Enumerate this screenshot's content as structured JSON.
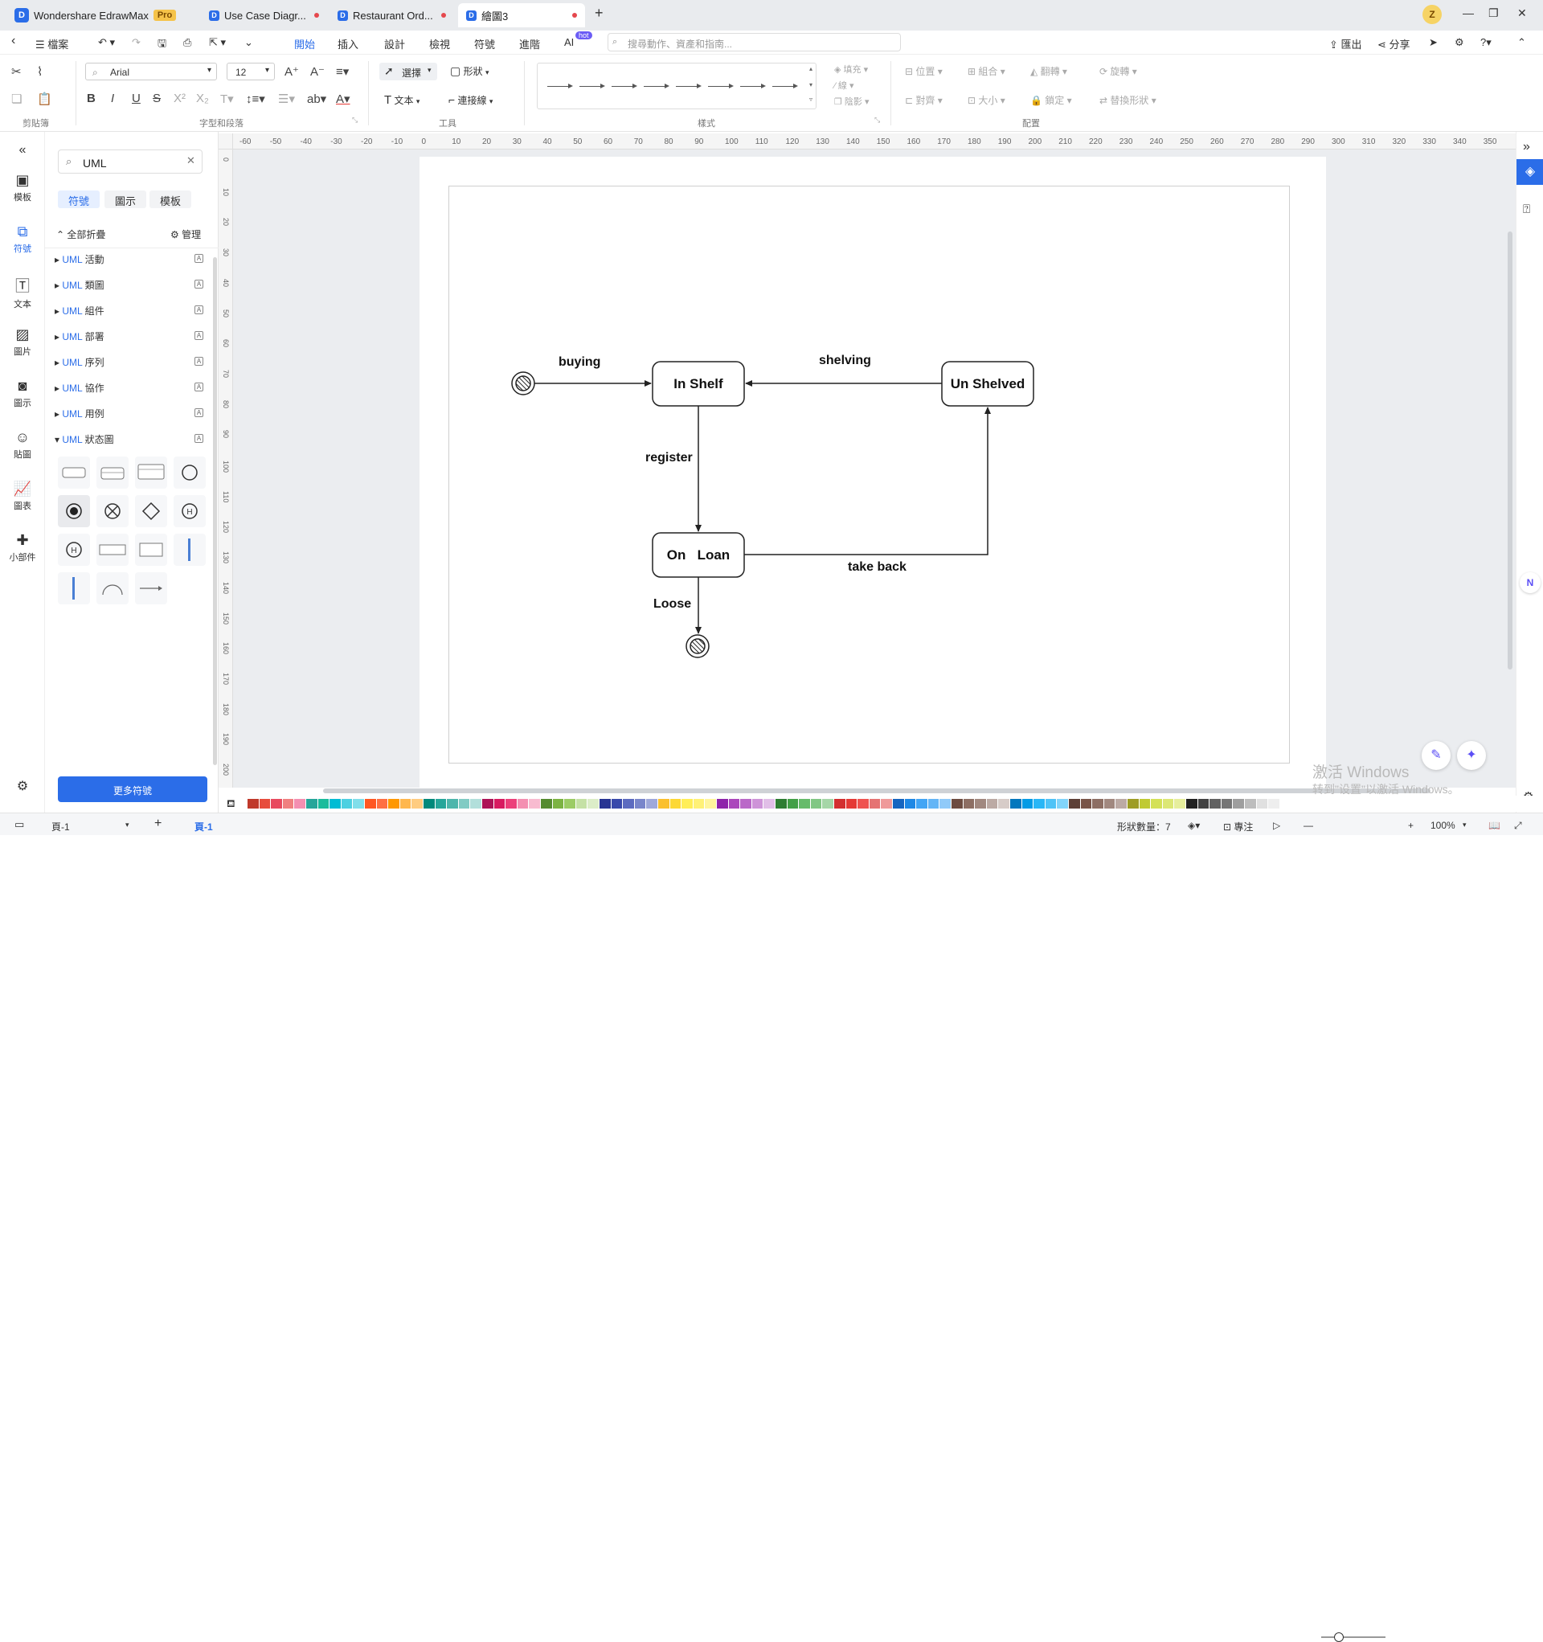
{
  "tabs": [
    {
      "label": "Wondershare EdrawMax",
      "badge": "Pro"
    },
    {
      "label": "Use Case Diagr..."
    },
    {
      "label": "Restaurant Ord..."
    },
    {
      "label": "繪圖3"
    }
  ],
  "user_initial": "Z",
  "menubar": {
    "file": "檔案",
    "items": [
      "開始",
      "插入",
      "設計",
      "檢視",
      "符號",
      "進階",
      "AI"
    ],
    "ai_badge": "hot",
    "search_placeholder": "搜尋動作、資產和指南...",
    "export": "匯出",
    "share": "分享"
  },
  "ribbon": {
    "font_name": "Arial",
    "font_size": "12",
    "select_label": "選擇",
    "shape_label": "形狀",
    "text_label": "文本",
    "connector_label": "連接線",
    "fill_label": "填充",
    "line_label": "線",
    "shadow_label": "陰影",
    "position_label": "位置",
    "group_label": "組合",
    "flip_label": "翻轉",
    "rotate_label": "旋轉",
    "align_label": "對齊",
    "size_label": "大小",
    "lock_label": "鎖定",
    "replace_label": "替換形狀",
    "groups": {
      "clipboard": "剪貼簿",
      "font": "字型和段落",
      "tools": "工具",
      "style": "樣式",
      "arrange": "配置"
    }
  },
  "left_rail": [
    {
      "label": "模板",
      "icon": "template-icon"
    },
    {
      "label": "符號",
      "icon": "symbol-icon"
    },
    {
      "label": "文本",
      "icon": "text-icon"
    },
    {
      "label": "圖片",
      "icon": "image-icon"
    },
    {
      "label": "圖示",
      "icon": "icon-icon"
    },
    {
      "label": "貼圖",
      "icon": "sticker-icon"
    },
    {
      "label": "圖表",
      "icon": "chart-icon"
    },
    {
      "label": "小部件",
      "icon": "widget-icon"
    }
  ],
  "library": {
    "search_value": "UML",
    "tabs": [
      "符號",
      "圖示",
      "模板"
    ],
    "collapse_all": "全部折疊",
    "manage": "管理",
    "categories": [
      {
        "prefix": "UML",
        "name": "活動"
      },
      {
        "prefix": "UML",
        "name": "類圖"
      },
      {
        "prefix": "UML",
        "name": "組件"
      },
      {
        "prefix": "UML",
        "name": "部署"
      },
      {
        "prefix": "UML",
        "name": "序列"
      },
      {
        "prefix": "UML",
        "name": "協作"
      },
      {
        "prefix": "UML",
        "name": "用例"
      },
      {
        "prefix": "UML",
        "name": "狀态圖"
      }
    ],
    "more_button": "更多符號"
  },
  "ruler": {
    "h_ticks": [
      "-60",
      "-50",
      "-40",
      "-30",
      "-20",
      "-10",
      "0",
      "10",
      "20",
      "30",
      "40",
      "50",
      "60",
      "70",
      "80",
      "90",
      "100",
      "110",
      "120",
      "130",
      "140",
      "150",
      "160",
      "170",
      "180",
      "190",
      "200",
      "210",
      "220",
      "230",
      "240",
      "250",
      "260",
      "270",
      "280",
      "290",
      "300",
      "310",
      "320",
      "330",
      "340",
      "350"
    ],
    "v_ticks": [
      "0",
      "10",
      "20",
      "30",
      "40",
      "50",
      "60",
      "70",
      "80",
      "90",
      "100",
      "110",
      "120",
      "130",
      "140",
      "150",
      "160",
      "170",
      "180",
      "190",
      "200"
    ]
  },
  "diagram": {
    "states": {
      "in_shelf": "In Shelf",
      "un_shelved": "Un Shelved",
      "on_loan": "On   Loan"
    },
    "transitions": {
      "buying": "buying",
      "shelving": "shelving",
      "register": "register",
      "take_back": "take back",
      "loose": "Loose"
    }
  },
  "palette": [
    "#c0392b",
    "#e74c3c",
    "#e84a5f",
    "#f08080",
    "#f48fb1",
    "#26a69a",
    "#1abc9c",
    "#00bcd4",
    "#4dd0e1",
    "#80deea",
    "#ff5722",
    "#ff7043",
    "#ff9800",
    "#ffb74d",
    "#ffcc80",
    "#00897b",
    "#26a69a",
    "#4db6ac",
    "#80cbc4",
    "#b2dfdb",
    "#ad1457",
    "#d81b60",
    "#ec407a",
    "#f48fb1",
    "#f8bbd0",
    "#558b2f",
    "#7cb342",
    "#9ccc65",
    "#c5e1a5",
    "#dcedc8",
    "#283593",
    "#3949ab",
    "#5c6bc0",
    "#7986cb",
    "#9fa8da",
    "#fbc02d",
    "#fdd835",
    "#ffee58",
    "#fff176",
    "#fff59d",
    "#8e24aa",
    "#ab47bc",
    "#ba68c8",
    "#ce93d8",
    "#e1bee7",
    "#2e7d32",
    "#43a047",
    "#66bb6a",
    "#81c784",
    "#a5d6a7",
    "#d32f2f",
    "#e53935",
    "#ef5350",
    "#e57373",
    "#ef9a9a",
    "#1565c0",
    "#1e88e5",
    "#42a5f5",
    "#64b5f6",
    "#90caf9",
    "#6d4c41",
    "#8d6e63",
    "#a1887f",
    "#bcaaa4",
    "#d7ccc8",
    "#0277bd",
    "#039be5",
    "#29b6f6",
    "#4fc3f7",
    "#81d4fa",
    "#5d4037",
    "#795548",
    "#8d6e63",
    "#a1887f",
    "#bcaaa4",
    "#9e9d24",
    "#c0ca33",
    "#d4e157",
    "#dce775",
    "#e6ee9c",
    "#212121",
    "#424242",
    "#616161",
    "#757575",
    "#9e9e9e",
    "#bdbdbd",
    "#e0e0e0",
    "#eeeeee"
  ],
  "status": {
    "page_selector": "頁-1",
    "page_tab": "頁-1",
    "shape_count": "形狀數量：7",
    "focus": "專注",
    "zoom": "100%"
  },
  "watermark": {
    "line1": "激活 Windows",
    "line2": "转到\"设置\"以激活 Windows。"
  },
  "colors": {
    "accent": "#2b6de8",
    "canvas": "#ebedf0"
  }
}
